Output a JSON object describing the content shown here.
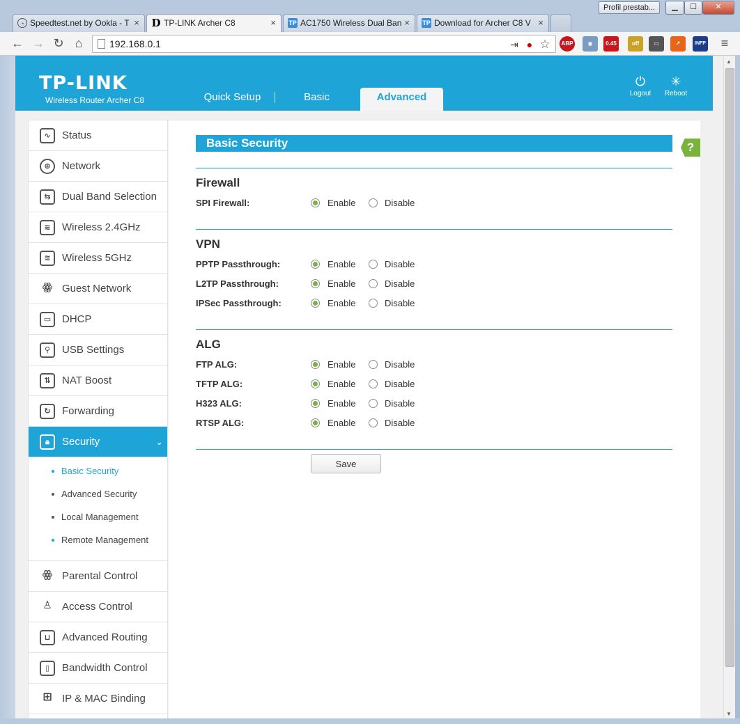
{
  "browser": {
    "profile_label": "Profil prestab...",
    "tabs": [
      {
        "title": "Speedtest.net by Ookla - T",
        "favicon": "speedtest-icon"
      },
      {
        "title": "TP-LINK Archer C8",
        "favicon": "D"
      },
      {
        "title": "AC1750 Wireless Dual Ban",
        "favicon": "TP"
      },
      {
        "title": "Download for Archer C8 V",
        "favicon": "TP"
      }
    ],
    "url": "192.168.0.1",
    "ext_labels": {
      "abp": "ABP",
      "speed_badge": "0.45",
      "off_badge": "off",
      "infp": "INFP"
    }
  },
  "router": {
    "logo": "TP-LINK",
    "model": "Wireless Router Archer C8",
    "nav": {
      "quick_setup": "Quick Setup",
      "basic": "Basic",
      "advanced": "Advanced"
    },
    "logout": "Logout",
    "reboot": "Reboot"
  },
  "sidebar": {
    "items": [
      {
        "label": "Status",
        "icon": "status-icon"
      },
      {
        "label": "Network",
        "icon": "globe-icon"
      },
      {
        "label": "Dual Band Selection",
        "icon": "dual-band-icon"
      },
      {
        "label": "Wireless 2.4GHz",
        "icon": "wifi-icon"
      },
      {
        "label": "Wireless 5GHz",
        "icon": "wifi-icon"
      },
      {
        "label": "Guest Network",
        "icon": "guest-icon"
      },
      {
        "label": "DHCP",
        "icon": "monitor-icon"
      },
      {
        "label": "USB Settings",
        "icon": "usb-icon"
      },
      {
        "label": "NAT Boost",
        "icon": "nat-icon"
      },
      {
        "label": "Forwarding",
        "icon": "forwarding-icon"
      },
      {
        "label": "Security",
        "icon": "lock-icon"
      }
    ],
    "security_sub": [
      {
        "label": "Basic Security"
      },
      {
        "label": "Advanced Security"
      },
      {
        "label": "Local Management"
      },
      {
        "label": "Remote Management"
      }
    ],
    "items_after": [
      {
        "label": "Parental Control",
        "icon": "family-icon"
      },
      {
        "label": "Access Control",
        "icon": "access-icon"
      },
      {
        "label": "Advanced Routing",
        "icon": "routing-icon"
      },
      {
        "label": "Bandwidth Control",
        "icon": "bandwidth-icon"
      },
      {
        "label": "IP & MAC Binding",
        "icon": "binding-icon"
      }
    ]
  },
  "content": {
    "title": "Basic Security",
    "help": "?",
    "enable": "Enable",
    "disable": "Disable",
    "save": "Save",
    "sections": {
      "firewall": {
        "title": "Firewall",
        "rows": [
          {
            "label": "SPI Firewall:",
            "value": "Enable"
          }
        ]
      },
      "vpn": {
        "title": "VPN",
        "rows": [
          {
            "label": "PPTP Passthrough:",
            "value": "Enable"
          },
          {
            "label": "L2TP Passthrough:",
            "value": "Enable"
          },
          {
            "label": "IPSec Passthrough:",
            "value": "Enable"
          }
        ]
      },
      "alg": {
        "title": "ALG",
        "rows": [
          {
            "label": "FTP ALG:",
            "value": "Enable"
          },
          {
            "label": "TFTP ALG:",
            "value": "Enable"
          },
          {
            "label": "H323 ALG:",
            "value": "Enable"
          },
          {
            "label": "RTSP ALG:",
            "value": "Enable"
          }
        ]
      }
    }
  },
  "colors": {
    "accent": "#1fa4d8",
    "radio_on": "#7ab33b",
    "help": "#7ab33b"
  }
}
